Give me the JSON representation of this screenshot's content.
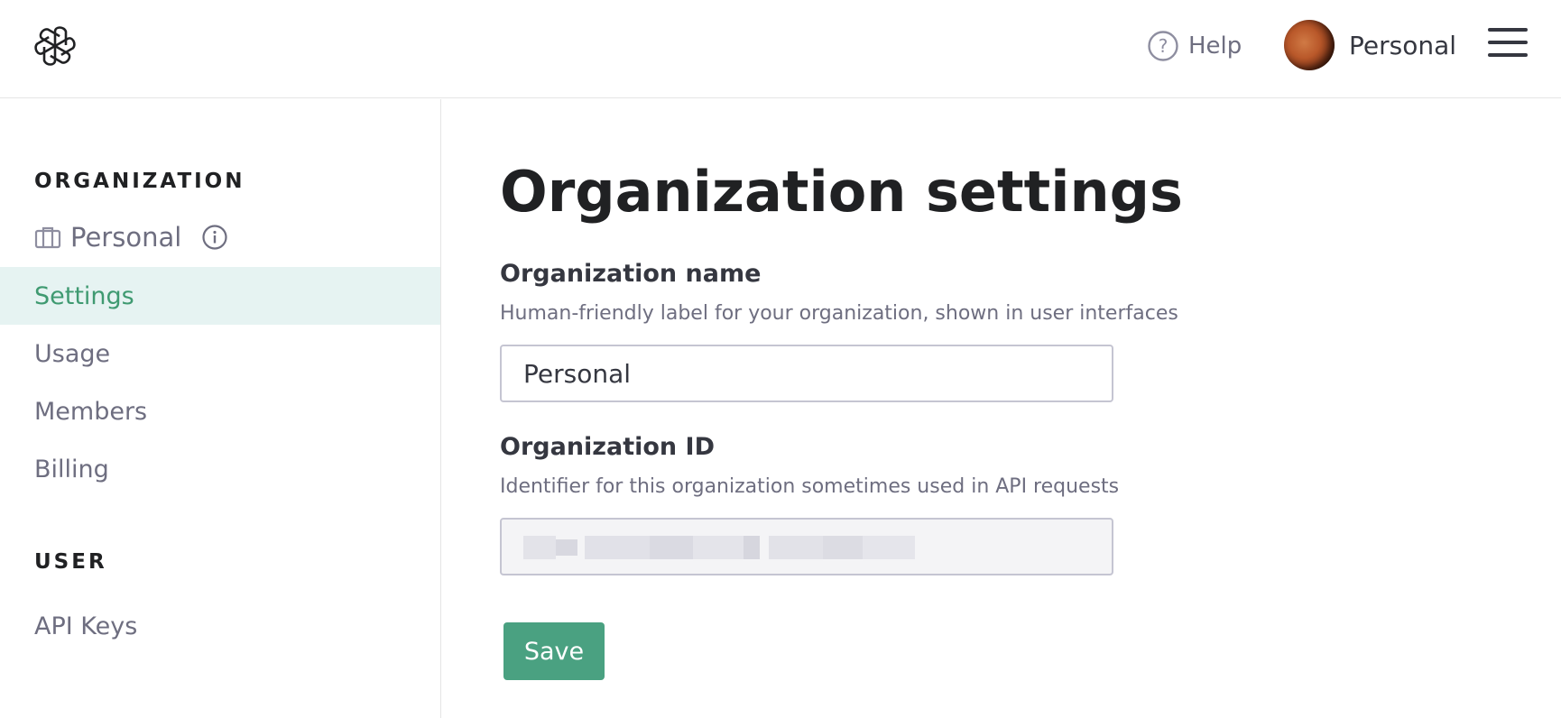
{
  "header": {
    "logo_icon": "openai-logo-icon",
    "help_label": "Help",
    "help_icon": "question-circle-icon",
    "account_name": "Personal",
    "menu_icon": "hamburger-menu-icon"
  },
  "sidebar": {
    "organization_title": "ORGANIZATION",
    "org_name": "Personal",
    "org_icon": "briefcase-icon",
    "info_icon": "info-circle-icon",
    "org_items": [
      {
        "label": "Settings",
        "active": true
      },
      {
        "label": "Usage",
        "active": false
      },
      {
        "label": "Members",
        "active": false
      },
      {
        "label": "Billing",
        "active": false
      }
    ],
    "user_title": "USER",
    "user_items": [
      {
        "label": "API Keys",
        "active": false
      }
    ]
  },
  "main": {
    "title": "Organization settings",
    "org_name_label": "Organization name",
    "org_name_help": "Human-friendly label for your organization, shown in user interfaces",
    "org_name_value": "Personal",
    "org_id_label": "Organization ID",
    "org_id_help": "Identifier for this organization sometimes used in API requests",
    "save_label": "Save"
  },
  "colors": {
    "accent": "#4aa181",
    "active_bg": "#e6f3f2",
    "active_text": "#3f9a71",
    "muted_text": "#6e6e80"
  }
}
